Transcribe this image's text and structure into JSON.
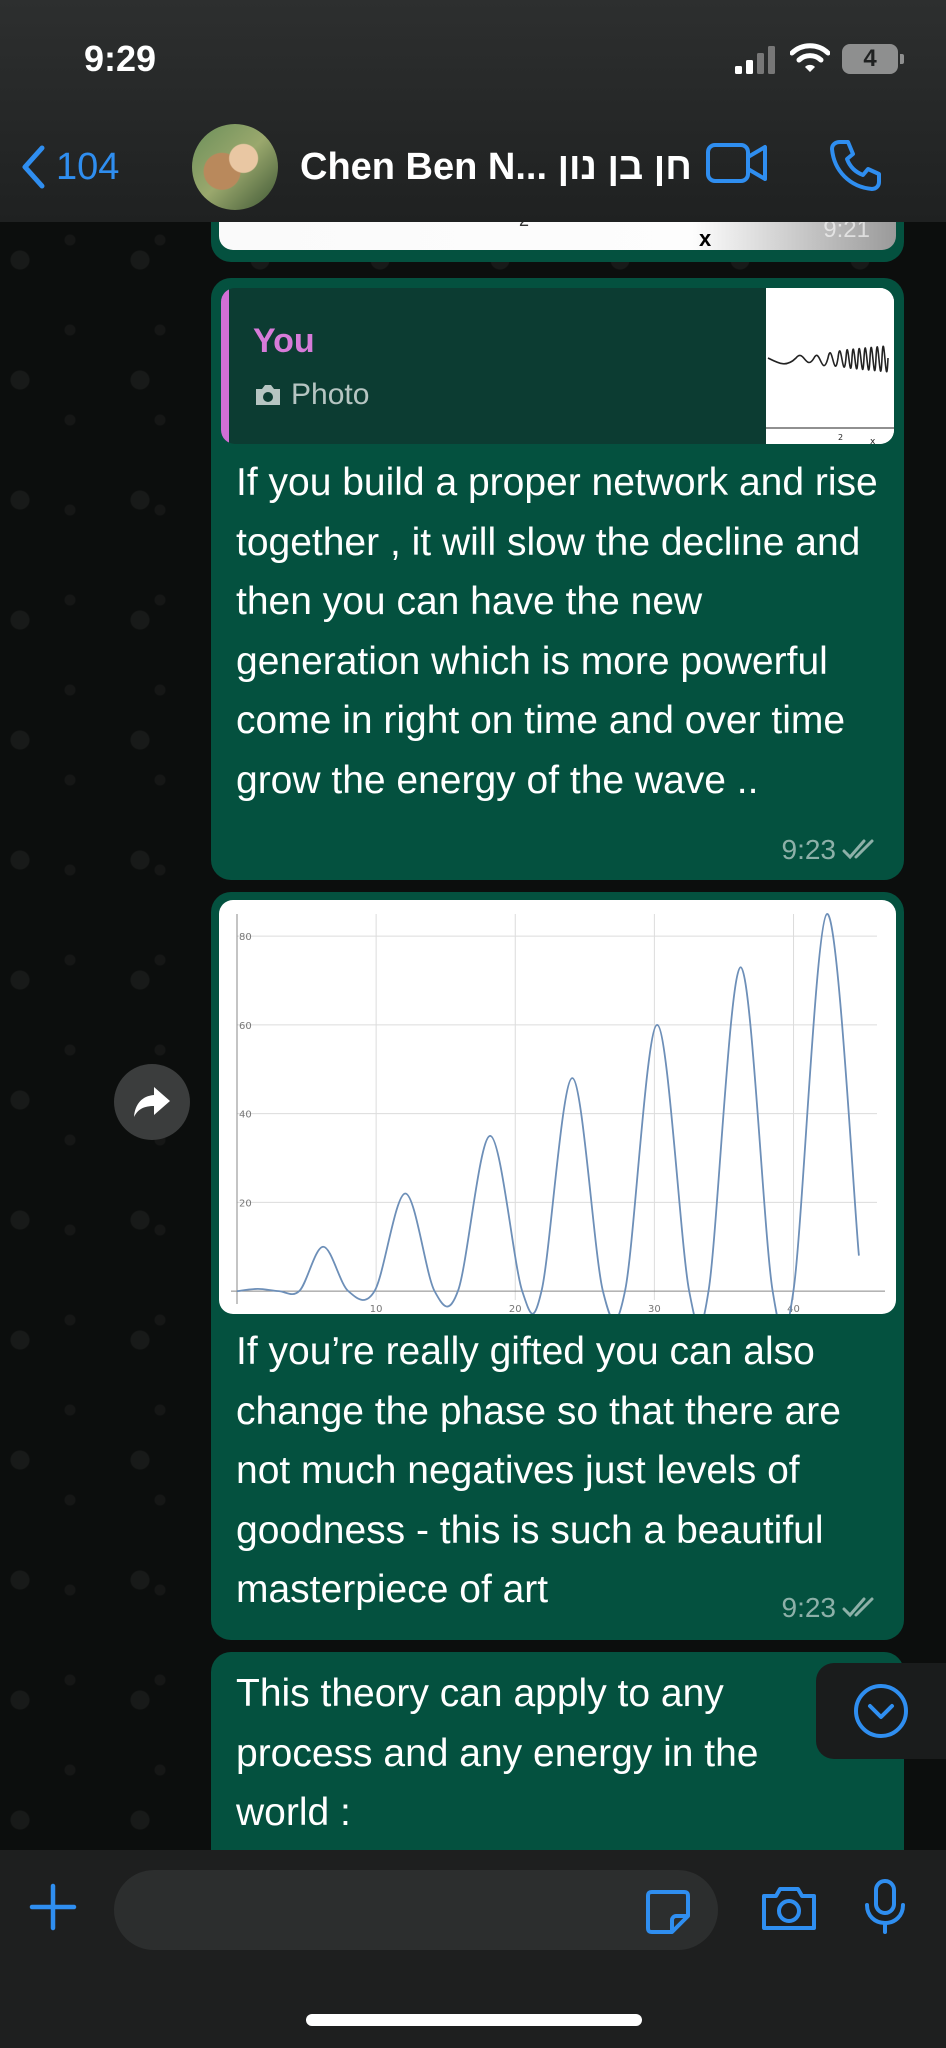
{
  "status_bar": {
    "time": "9:29",
    "battery": "4"
  },
  "header": {
    "back_count": "104",
    "contact_name": "Chen Ben N... חן בן נון"
  },
  "messages": {
    "stub": {
      "time": "9:21"
    },
    "reply_message": {
      "quote_author": "You",
      "quote_type": "Photo",
      "text": "If you build a proper network and rise together , it will slow the decline and then you can have the new generation which is more powerful come in right on time and over time grow the energy of the wave ..",
      "time": "9:23"
    },
    "chart_message": {
      "text": "If you’re really gifted you can also change the phase so that there are not much negatives just levels of goodness - this is such a beautiful masterpiece of art",
      "time": "9:23"
    },
    "last_message": {
      "text": "This theory can apply to any process and any energy in the world :"
    }
  },
  "input": {
    "placeholder": ""
  },
  "colors": {
    "bubble": "#04513f",
    "accent": "#2f8ef0",
    "quote_author": "#d77bd9"
  },
  "icons": [
    "signal-icon",
    "wifi-icon",
    "battery-icon",
    "chevron-left-icon",
    "video-camera-icon",
    "phone-icon",
    "camera-icon",
    "double-check-icon",
    "forward-icon",
    "chevron-down-icon",
    "plus-icon",
    "sticker-icon",
    "microphone-icon"
  ],
  "chart_data": {
    "type": "line",
    "title": "",
    "xlabel": "",
    "ylabel": "",
    "xlim": [
      0,
      46
    ],
    "ylim": [
      -2,
      85
    ],
    "xticks": [
      "10",
      "20",
      "30",
      "40"
    ],
    "yticks": [
      "20",
      "40",
      "60",
      "80"
    ],
    "grid": true,
    "series": [
      {
        "x": [
          0,
          1.5,
          3,
          4.5,
          6.2,
          8,
          9.9,
          12.1,
          14.2,
          15.9,
          18.2,
          20.5,
          21.9,
          24.1,
          26.3,
          27.9,
          30.2,
          32.5,
          33.9,
          36.2,
          38.5,
          40.0,
          42.4,
          44.7
        ],
        "y": [
          0,
          0.5,
          0,
          0.1,
          10,
          0,
          0.1,
          22,
          0,
          0.2,
          35,
          0,
          0.2,
          48,
          0,
          0.2,
          60,
          0,
          0.2,
          73,
          0,
          0.2,
          85,
          8
        ]
      }
    ]
  }
}
